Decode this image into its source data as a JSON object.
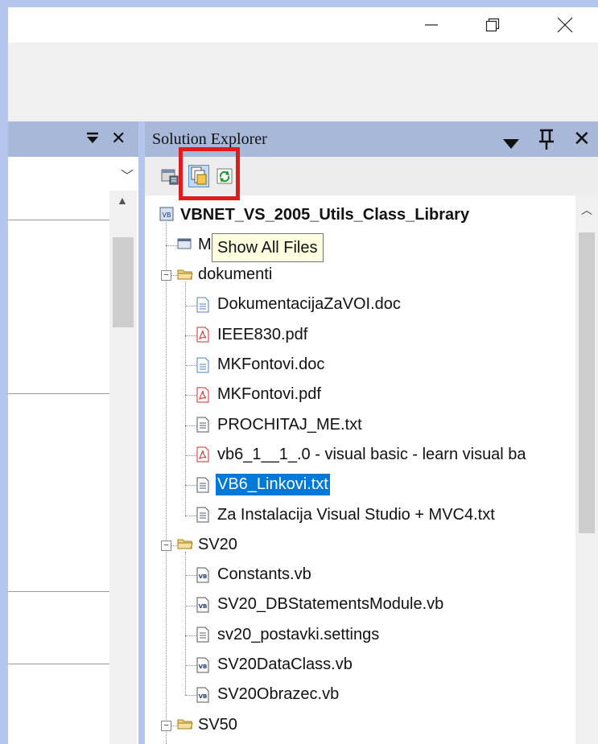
{
  "window": {
    "minimize_icon": "minimize-icon",
    "restore_icon": "restore-icon",
    "close_icon": "close-icon"
  },
  "left_panel": {
    "buttons": [
      "pin-dropdown-icon",
      "close-icon"
    ]
  },
  "solution_explorer": {
    "title": "Solution Explorer",
    "toolbar": [
      {
        "name": "properties-button"
      },
      {
        "name": "show-all-files-button",
        "active": true
      },
      {
        "name": "refresh-button"
      }
    ],
    "tooltip": "Show All Files",
    "highlight_color": "#e01b1b",
    "selection_color": "#0078d7",
    "tree": [
      {
        "label": "VBNET_VS_2005_Utils_Class_Library",
        "icon": "vb-project-icon",
        "level": 0,
        "bold": true
      },
      {
        "label": "M",
        "icon": "my-project-icon",
        "level": 1
      },
      {
        "label": "dokumenti",
        "icon": "folder-icon",
        "level": 1,
        "expanded": true
      },
      {
        "label": "DokumentacijaZaVOI.doc",
        "icon": "word-doc-icon",
        "level": 2
      },
      {
        "label": "IEEE830.pdf",
        "icon": "pdf-icon",
        "level": 2
      },
      {
        "label": "MKFontovi.doc",
        "icon": "word-doc-icon",
        "level": 2
      },
      {
        "label": "MKFontovi.pdf",
        "icon": "pdf-icon",
        "level": 2
      },
      {
        "label": "PROCHITAJ_ME.txt",
        "icon": "text-file-icon",
        "level": 2
      },
      {
        "label": "vb6_1__1_.0 - visual basic - learn visual ba",
        "icon": "pdf-icon",
        "level": 2
      },
      {
        "label": "VB6_Linkovi.txt",
        "icon": "text-file-icon",
        "level": 2,
        "selected": true
      },
      {
        "label": "Za Instalacija Visual Studio + MVC4.txt",
        "icon": "text-file-icon",
        "level": 2
      },
      {
        "label": "SV20",
        "icon": "folder-icon",
        "level": 1,
        "expanded": true
      },
      {
        "label": "Constants.vb",
        "icon": "vb-file-icon",
        "level": 2
      },
      {
        "label": "SV20_DBStatementsModule.vb",
        "icon": "vb-file-icon",
        "level": 2
      },
      {
        "label": "sv20_postavki.settings",
        "icon": "settings-file-icon",
        "level": 2
      },
      {
        "label": "SV20DataClass.vb",
        "icon": "vb-file-icon",
        "level": 2
      },
      {
        "label": "SV20Obrazec.vb",
        "icon": "vb-file-icon",
        "level": 2
      },
      {
        "label": "SV50",
        "icon": "folder-icon",
        "level": 1,
        "expanded": true
      }
    ]
  }
}
